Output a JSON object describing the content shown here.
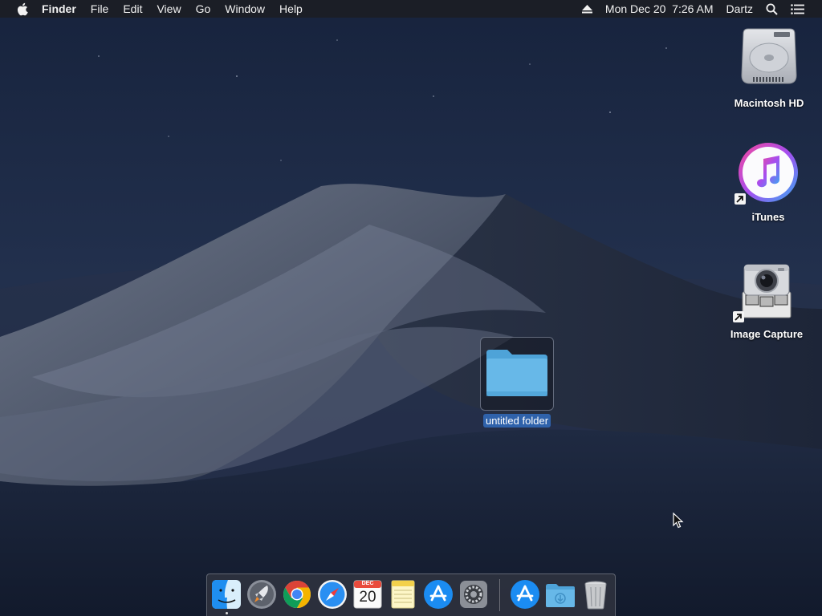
{
  "menubar": {
    "app_name": "Finder",
    "menus": [
      "File",
      "Edit",
      "View",
      "Go",
      "Window",
      "Help"
    ],
    "datetime": "Mon Dec 20  7:26 AM",
    "user": "Dartz",
    "icons": [
      "apple-icon",
      "eject-icon",
      "spotlight-search-icon",
      "notification-center-icon"
    ]
  },
  "desktop": {
    "icons": [
      {
        "label": "Macintosh HD",
        "icon": "hard-drive-icon"
      },
      {
        "label": "iTunes",
        "icon": "itunes-icon",
        "alias": true
      },
      {
        "label": "Image Capture",
        "icon": "image-capture-icon",
        "alias": true
      }
    ],
    "folder": {
      "label": "untitled folder",
      "selected": true,
      "icon": "folder-icon"
    }
  },
  "dock": {
    "apps": [
      "finder-icon",
      "launchpad-icon",
      "chrome-icon",
      "safari-icon",
      "calendar-icon",
      "notes-icon",
      "app-store-icon",
      "system-preferences-icon"
    ],
    "calendar": {
      "month": "DEC",
      "day": "20"
    },
    "after_separator": [
      "app-store-icon",
      "downloads-folder-icon",
      "trash-icon"
    ]
  },
  "colors": {
    "menubar": "#1c1e24",
    "selection": "#2f62ab",
    "folder": "#5bb1e3",
    "sky": "#1b2843"
  }
}
